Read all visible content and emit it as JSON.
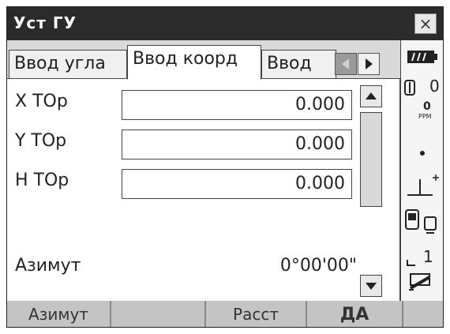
{
  "window": {
    "title": "Уст ГУ",
    "close_label": "×"
  },
  "tabs": [
    "Ввод угла",
    "Ввод коорд",
    "Ввод"
  ],
  "fields": [
    {
      "label": "X ТОр",
      "value": "0.000"
    },
    {
      "label": "Y ТОр",
      "value": "0.000"
    },
    {
      "label": "H ТОр",
      "value": "0.000"
    }
  ],
  "azimuth": {
    "label": "Азимут",
    "value": "0°00'00\""
  },
  "status_bar": {
    "prism_constant": "0",
    "ppm_value": "0",
    "ppm_unit": "PPM",
    "level": "1"
  },
  "softkeys": [
    "Азимут",
    "",
    "Расст",
    "ДА",
    ""
  ],
  "icons": [
    "battery-icon",
    "prism-icon",
    "ppm-icon",
    "dot-icon",
    "tilt-icon",
    "instrument-icon",
    "level-icon",
    "input-mode-icon"
  ]
}
